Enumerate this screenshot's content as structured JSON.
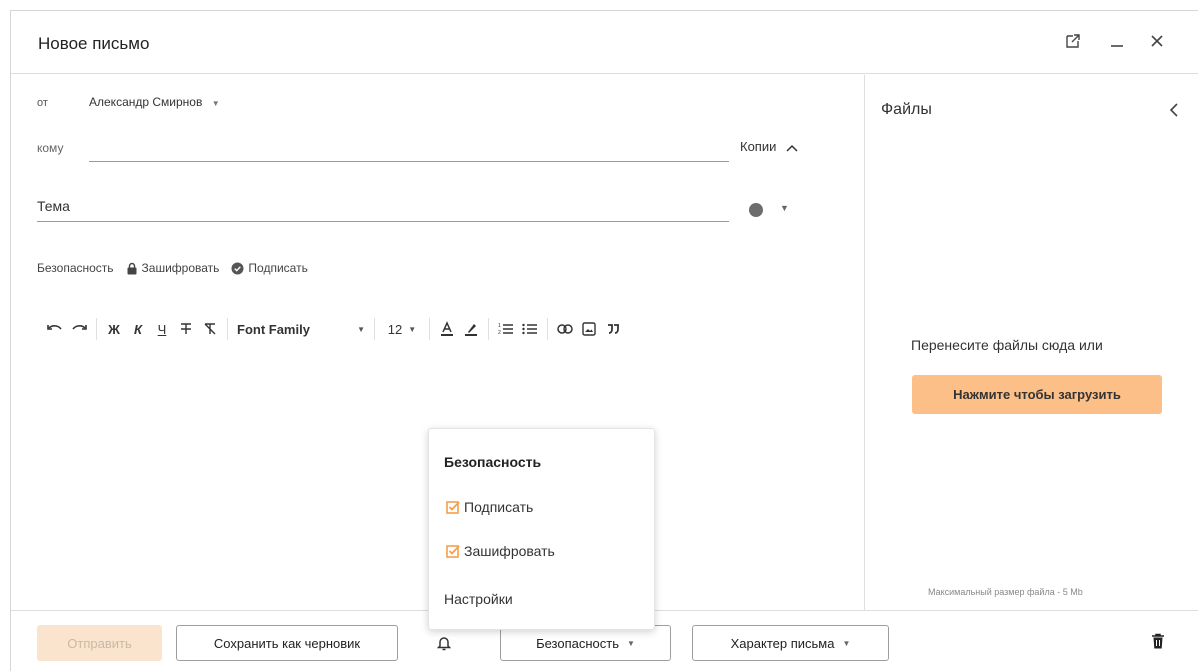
{
  "header": {
    "title": "Новое письмо",
    "icons": [
      "open-external-icon",
      "minimize-icon",
      "close-icon"
    ]
  },
  "compose": {
    "from_label": "от",
    "from_value": "Александр Смирнов",
    "to_label": "кому",
    "to_value": "",
    "copies_label": "Копии",
    "subject_placeholder": "Тема",
    "security_label": "Безопасность",
    "encrypt_label": "Зашифровать",
    "sign_label": "Подписать",
    "toolbar": {
      "bold": "Ж",
      "italic": "К",
      "underline": "Ч",
      "font_family": "Font Family",
      "font_size": "12"
    }
  },
  "files": {
    "title": "Файлы",
    "drop_text": "Перенесите файлы сюда или",
    "upload_label": "Нажмите чтобы загрузить",
    "max_size": "Максимальный размер файла - 5 Mb"
  },
  "footer": {
    "send_label": "Отправить",
    "draft_label": "Сохранить как черновик",
    "security_label": "Безопасность",
    "character_label": "Характер письма"
  },
  "popup": {
    "title": "Безопасность",
    "items": [
      {
        "label": "Подписать",
        "checked": true
      },
      {
        "label": "Зашифровать",
        "checked": true
      }
    ],
    "settings_label": "Настройки"
  },
  "colors": {
    "accent": "#f5a04a",
    "upload_bg": "#fbbf87",
    "send_disabled_bg": "#fbe4ce"
  }
}
